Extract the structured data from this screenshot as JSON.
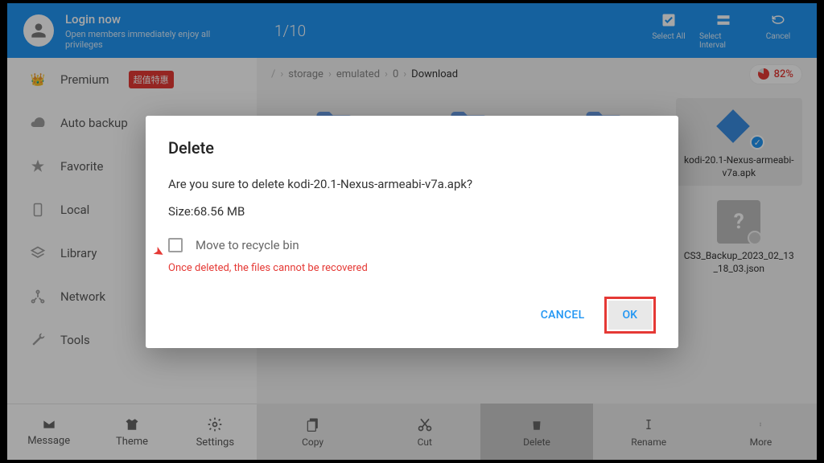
{
  "header": {
    "login_title": "Login now",
    "login_sub": "Open members immediately enjoy all privileges",
    "counter": "1/10",
    "actions": {
      "select_all": "Select All",
      "select_interval": "Select Interval",
      "cancel": "Cancel"
    }
  },
  "sidebar": {
    "items": [
      {
        "label": "Premium",
        "badge": "超值特惠"
      },
      {
        "label": "Auto backup"
      },
      {
        "label": "Favorite"
      },
      {
        "label": "Local"
      },
      {
        "label": "Library"
      },
      {
        "label": "Network"
      },
      {
        "label": "Tools"
      }
    ],
    "bottom": {
      "message": "Message",
      "theme": "Theme",
      "settings": "Settings"
    }
  },
  "breadcrumb": {
    "parts": [
      "storage",
      "emulated",
      "0",
      "Download"
    ],
    "storage_pct": "82%"
  },
  "files": [
    {
      "name": "",
      "type": "folder"
    },
    {
      "name": "",
      "type": "folder"
    },
    {
      "name": "",
      "type": "folder"
    },
    {
      "name": "kodi-20.1-Nexus-armeabi-v7a.apk",
      "type": "apk",
      "selected": true
    },
    {
      "name": "",
      "type": "blank"
    },
    {
      "name": "",
      "type": "blank"
    },
    {
      "name": "",
      "type": "blank"
    },
    {
      "name": "CS3_Backup_2023_02_13_18_03.json",
      "type": "json"
    }
  ],
  "toolbar": {
    "copy": "Copy",
    "cut": "Cut",
    "delete": "Delete",
    "rename": "Rename",
    "more": "More"
  },
  "dialog": {
    "title": "Delete",
    "message": "Are you sure to delete kodi-20.1-Nexus-armeabi-v7a.apk?",
    "size": "Size:68.56 MB",
    "checkbox_label": "Move to recycle bin",
    "warning": "Once deleted, the files cannot be recovered",
    "cancel": "CANCEL",
    "ok": "OK"
  }
}
